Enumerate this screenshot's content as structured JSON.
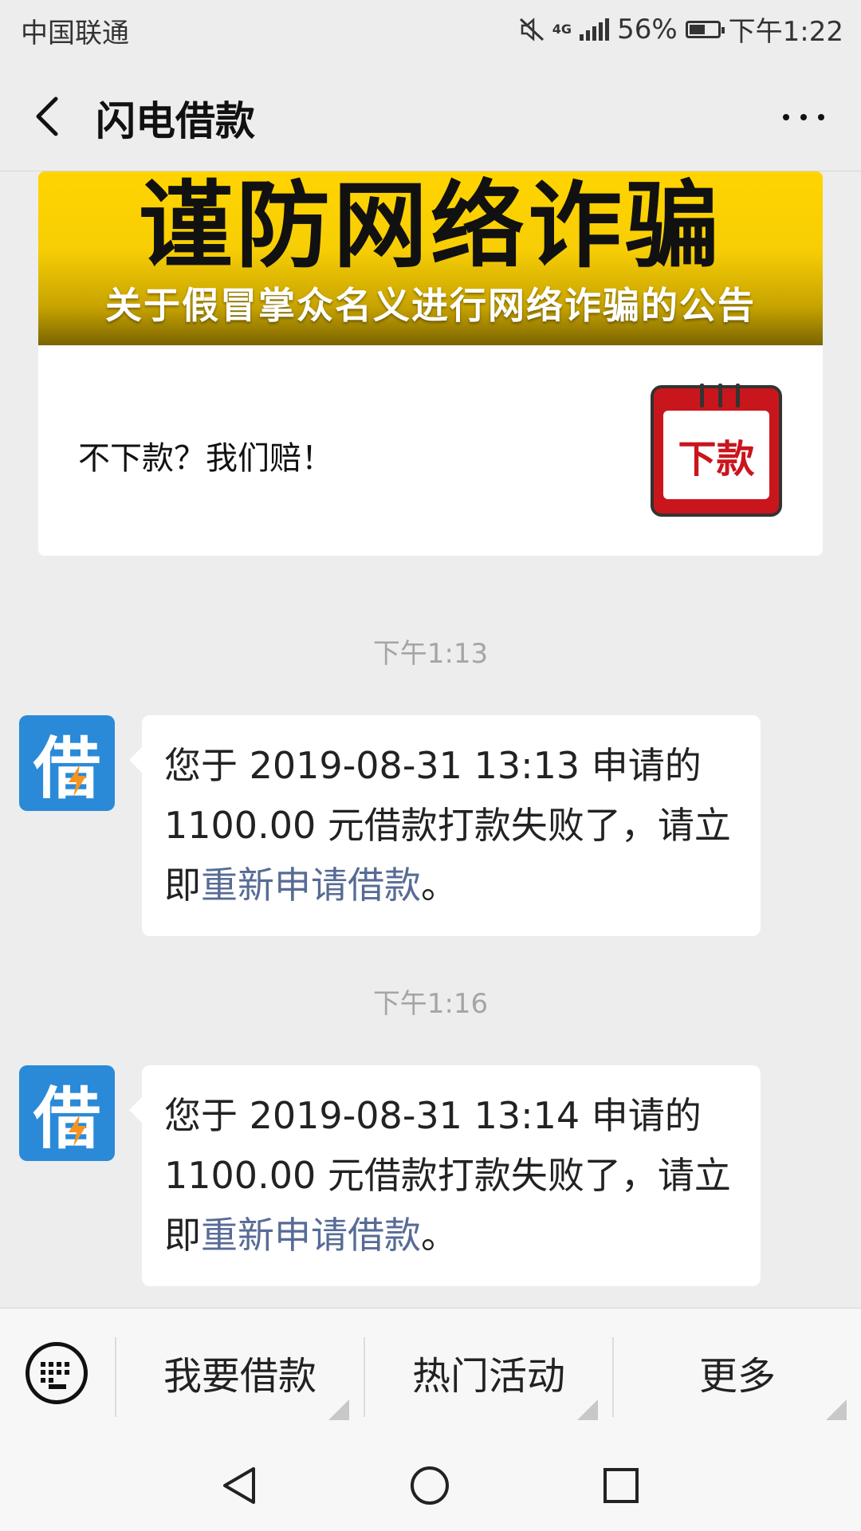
{
  "status_bar": {
    "carrier": "中国联通",
    "network": "4G",
    "battery": "56%",
    "battery_level": 0.56,
    "time": "下午1:22"
  },
  "nav": {
    "title": "闪电借款"
  },
  "card": {
    "banner_title": "谨防网络诈骗",
    "banner_subtitle": "关于假冒掌众名义进行网络诈骗的公告",
    "text": "不下款？我们赔！",
    "thumb_label": "下款"
  },
  "messages": [
    {
      "time": "下午1:13",
      "avatar": "借",
      "text_before": "您于 2019-08-31 13:13 申请的 1100.00 元借款打款失败了，请立即",
      "link": "重新申请借款",
      "text_after": "。"
    },
    {
      "time": "下午1:16",
      "avatar": "借",
      "text_before": "您于 2019-08-31 13:14 申请的 1100.00 元借款打款失败了，请立即",
      "link": "重新申请借款",
      "text_after": "。"
    }
  ],
  "bottom_menu": {
    "items": [
      "我要借款",
      "热门活动",
      "更多"
    ]
  },
  "icons": {
    "back": "back-arrow-icon",
    "more": "more-dots-icon",
    "keyboard": "keyboard-icon",
    "sys_back": "triangle-back-icon",
    "sys_home": "circle-home-icon",
    "sys_recent": "square-recent-icon"
  },
  "colors": {
    "link": "#576b95",
    "avatar": "#2a8ad8",
    "banner_yellow": "#ffd400"
  }
}
